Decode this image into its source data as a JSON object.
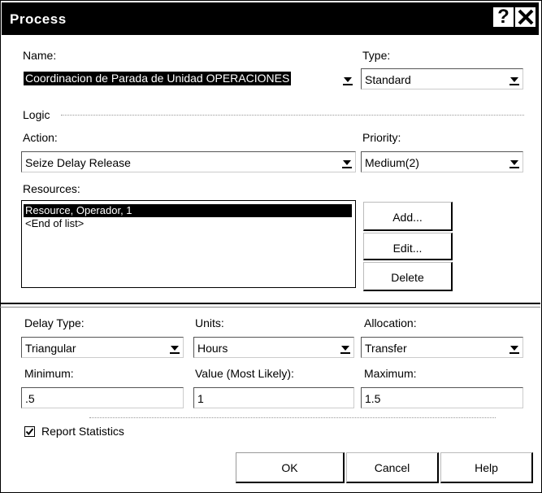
{
  "window": {
    "title": "Process"
  },
  "name": {
    "label": "Name:",
    "value": "Coordinacion de Parada de Unidad OPERACIONES"
  },
  "type": {
    "label": "Type:",
    "value": "Standard"
  },
  "logic": {
    "label": "Logic"
  },
  "action": {
    "label": "Action:",
    "value": "Seize Delay Release"
  },
  "priority": {
    "label": "Priority:",
    "value": "Medium(2)"
  },
  "resources": {
    "label": "Resources:",
    "items": [
      "Resource, Operador, 1",
      "<End of list>"
    ],
    "add_label": "Add...",
    "edit_label": "Edit...",
    "delete_label": "Delete"
  },
  "delay_type": {
    "label": "Delay Type:",
    "value": "Triangular"
  },
  "units": {
    "label": "Units:",
    "value": "Hours"
  },
  "allocation": {
    "label": "Allocation:",
    "value": "Transfer"
  },
  "minimum": {
    "label": "Minimum:",
    "value": ".5"
  },
  "most_likely": {
    "label": "Value (Most Likely):",
    "value": "1"
  },
  "maximum": {
    "label": "Maximum:",
    "value": "1.5"
  },
  "report_statistics": {
    "label": "Report Statistics",
    "checked": true
  },
  "buttons": {
    "ok": "OK",
    "cancel": "Cancel",
    "help": "Help"
  }
}
